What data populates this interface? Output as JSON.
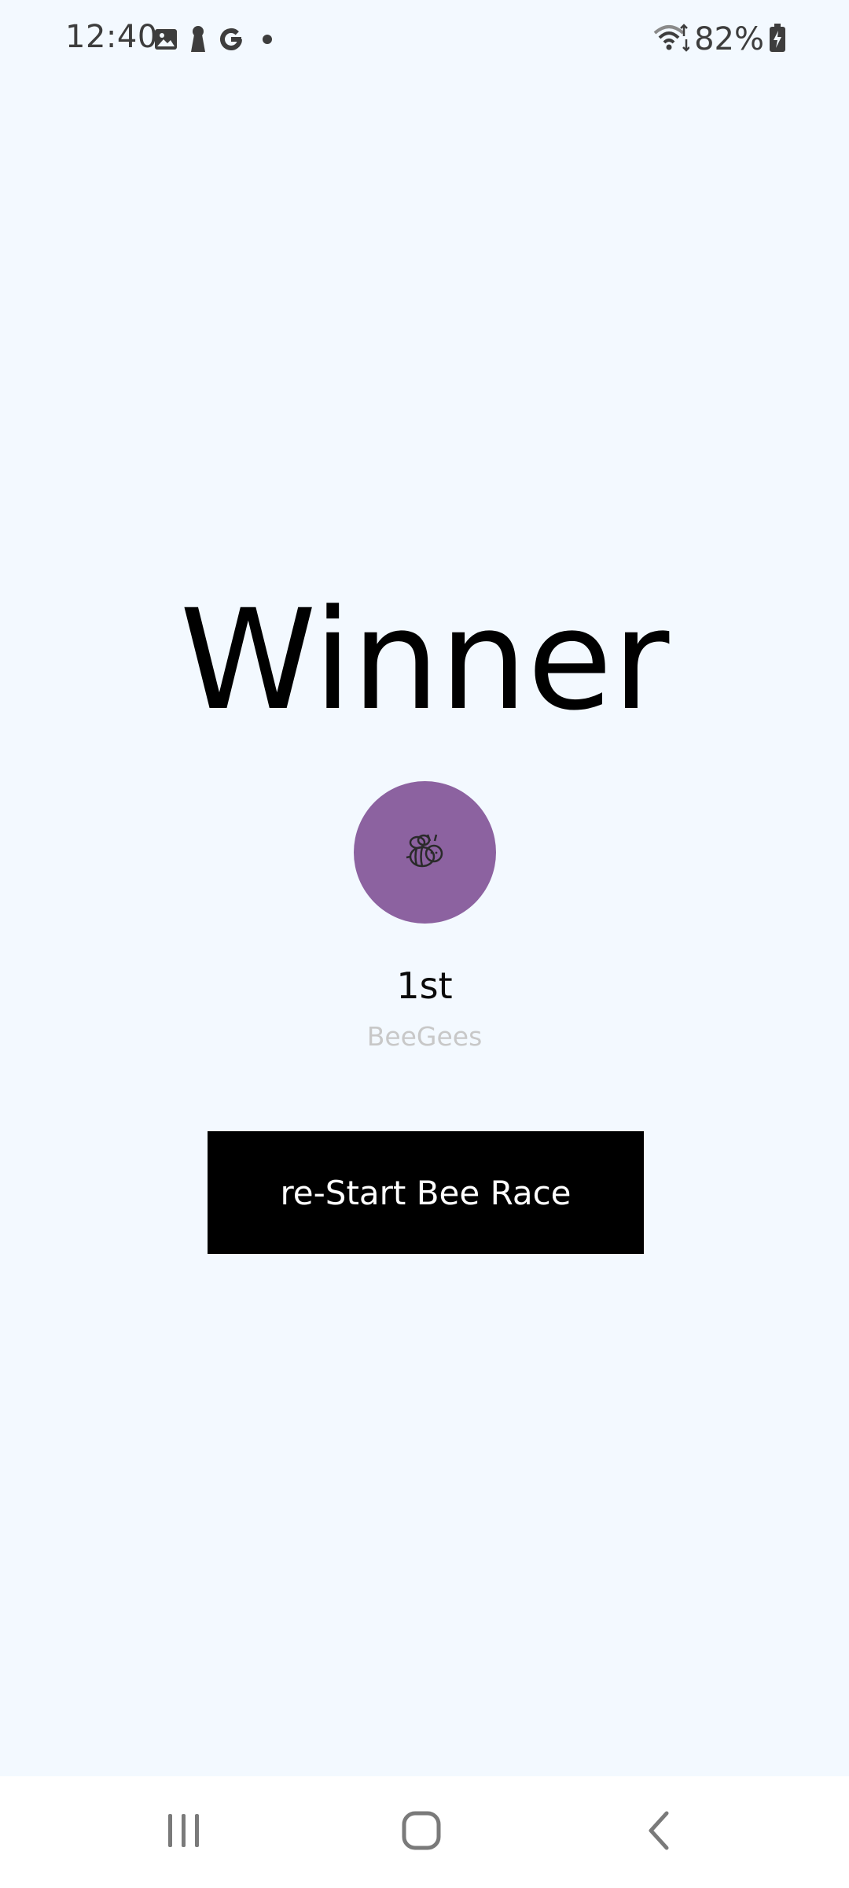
{
  "status_bar": {
    "time": "12:40",
    "left_icons": [
      "gallery-icon",
      "keyhole-icon",
      "google-icon",
      "dot-icon"
    ],
    "right_icons": [
      "wifi-icon",
      "battery-icon"
    ],
    "battery": "82%"
  },
  "main": {
    "title": "Winner",
    "avatar_icon": "bee-icon",
    "avatar_color": "#8c62a0",
    "place": "1st",
    "team_name": "BeeGees",
    "restart_label": "re-Start Bee Race"
  },
  "nav_bar": {
    "buttons": [
      "recent-apps-icon",
      "home-icon",
      "back-icon"
    ]
  },
  "colors": {
    "background": "#f3f9ff",
    "button_bg": "#000000",
    "button_text": "#ffffff",
    "team_text": "#c8c8c8"
  }
}
